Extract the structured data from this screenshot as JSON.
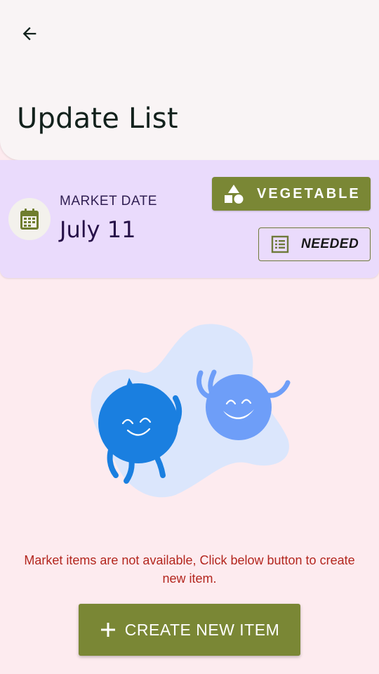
{
  "header": {
    "back_icon": "arrow-left-icon",
    "title": "Update List"
  },
  "info_card": {
    "calendar_icon": "calendar-icon",
    "market_label": "MARKET DATE",
    "market_date": "July 11",
    "category_chip": {
      "icon": "shapes-icon",
      "label": "VEGETABLE"
    },
    "status_chip": {
      "icon": "list-icon",
      "label": "NEEDED"
    }
  },
  "empty_state": {
    "illustration": "happy-blobs-illustration",
    "message": "Market items are not available, Click below button to create new item."
  },
  "create_button": {
    "icon": "plus-icon",
    "label": "CREATE NEW ITEM"
  },
  "colors": {
    "page_background": "#fdebef",
    "header_background": "#f9f4f5",
    "card_background": "#eadbfc",
    "accent_olive": "#7a8735",
    "error_text": "#b3261e",
    "blob_dark": "#1a7fe0",
    "blob_light": "#6e9ef8"
  }
}
